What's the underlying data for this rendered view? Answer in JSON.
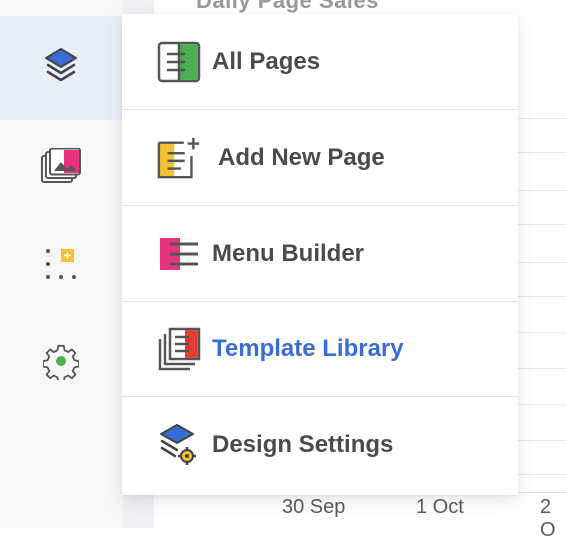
{
  "rail": {
    "items": [
      {
        "icon": "layers-icon",
        "active": true
      },
      {
        "icon": "media-gallery-icon",
        "active": false
      },
      {
        "icon": "widgets-grid-icon",
        "active": false
      },
      {
        "icon": "gear-icon",
        "active": false
      }
    ]
  },
  "background": {
    "title_partial": "Daily Page Sales",
    "dates": [
      "30 Sep",
      "1 Oct",
      "2 O"
    ]
  },
  "menu": {
    "items": [
      {
        "label": "All Pages",
        "icon": "all-pages-icon"
      },
      {
        "label": "Add New Page",
        "icon": "add-page-icon"
      },
      {
        "label": "Menu Builder",
        "icon": "menu-builder-icon"
      },
      {
        "label": "Template Library",
        "icon": "template-library-icon",
        "highlighted": true
      },
      {
        "label": "Design Settings",
        "icon": "design-settings-icon"
      }
    ]
  },
  "colors": {
    "accent": "#3b6bd6",
    "green": "#4caf50",
    "yellow": "#f5c033",
    "pink": "#e6337a",
    "red": "#e53935",
    "rail_active_bg": "#e9eefb"
  }
}
